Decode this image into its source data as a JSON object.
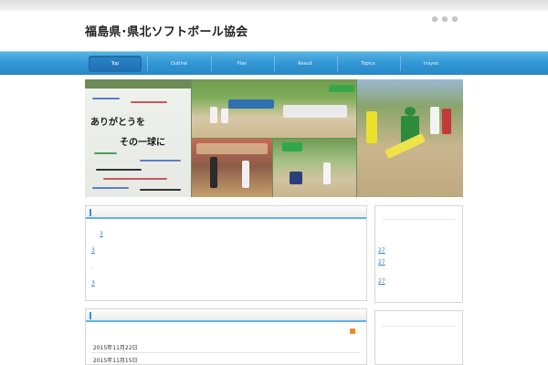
{
  "site": {
    "title": "福島県･県北ソフトボール協会"
  },
  "nav": {
    "items": [
      {
        "label": "Top"
      },
      {
        "label": "Outline"
      },
      {
        "label": "Plan"
      },
      {
        "label": "Result"
      },
      {
        "label": "Topics"
      },
      {
        "label": "Insyes"
      }
    ]
  },
  "hero": {
    "board_line_1": "ありがとうを",
    "board_line_2": "その一球に"
  },
  "main_box": {
    "links": [
      "3",
      "3",
      "3"
    ],
    "dot": "."
  },
  "side_box": {
    "links": [
      "27",
      "27",
      "27"
    ]
  },
  "news": {
    "dates": [
      "2015年11月22日",
      "2015年11月15日"
    ]
  },
  "colors": {
    "nav_blue": "#2f94d3",
    "accent_line": "#5fb3e3",
    "link": "#2a7fc4"
  },
  "icons": {
    "window_dots": "circle",
    "rss": "rss-icon"
  }
}
